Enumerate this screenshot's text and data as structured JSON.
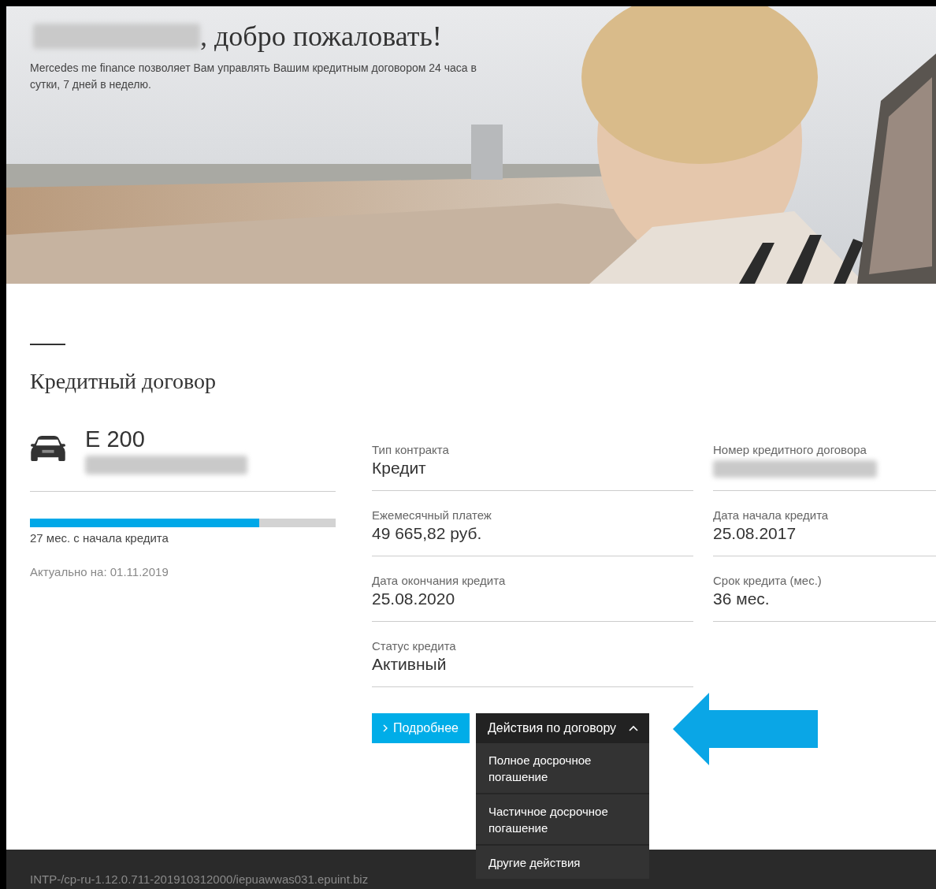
{
  "hero": {
    "name_blurred": true,
    "greeting": ", добро пожаловать!",
    "intro": "Mercedes me finance позволяет Вам управлять Вашим кредитным договором 24 часа в сутки, 7 дней в неделю."
  },
  "section": {
    "title": "Кредитный договор"
  },
  "vehicle": {
    "model": "E 200",
    "number_blurred": true
  },
  "progress": {
    "level": 0.75,
    "caption": "27 мес. с начала кредита"
  },
  "updated": "Актуально на: 01.11.2019",
  "fields": [
    {
      "label": "Тип контракта",
      "value": "Кредит",
      "blurred": false
    },
    {
      "label": "Номер кредитного договора",
      "blurred": true
    },
    {
      "label": "Ежемесячный платеж",
      "value": "49 665,82 руб.",
      "blurred": false
    },
    {
      "label": "Дата начала кредита",
      "value": "25.08.2017",
      "blurred": false
    },
    {
      "label": "Дата окончания кредита",
      "value": "25.08.2020",
      "blurred": false
    },
    {
      "label": "Срок кредита (мес.)",
      "value": "36 мес.",
      "blurred": false
    },
    {
      "label": "Статус кредита",
      "value": "Активный",
      "blurred": false
    }
  ],
  "details_button": {
    "label": "Подробнее"
  },
  "actions": {
    "label": "Действия по договору",
    "expanded": true,
    "items": [
      "Полное досрочное погашение",
      "Частичное досрочное погашение",
      "Другие действия"
    ]
  },
  "annotation": {
    "kind": "arrow"
  },
  "footer": {
    "text": "INTP-/cp-ru-1.12.0.711-201910312000/iepuawwas031.epuint.biz"
  }
}
